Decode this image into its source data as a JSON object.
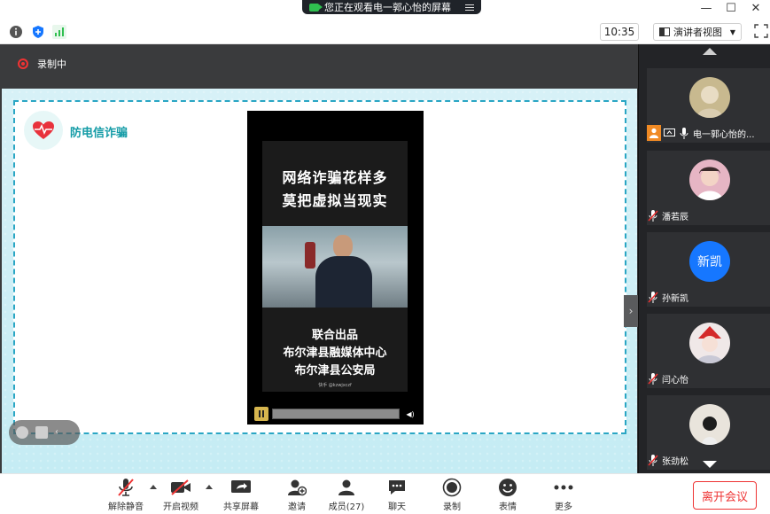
{
  "titlebar": {
    "share_status": "您正在观看电一郭心怡的屏幕",
    "minimize": "—",
    "maximize": "☐",
    "close": "✕"
  },
  "infobar": {
    "clock": "10:35",
    "view_mode": "演讲者视图"
  },
  "recording": {
    "label": "录制中"
  },
  "slide": {
    "title": "防电信诈骗",
    "video": {
      "headline_line1": "网络诈骗花样多",
      "headline_line2": "莫把虚拟当现实",
      "credit_line1": "联合出品",
      "credit_line2": "布尔津县融媒体中心",
      "credit_line3": "布尔津县公安局",
      "watermark": "快手 @kzwjxczf"
    }
  },
  "participants": [
    {
      "name": "电一郭心怡的...",
      "host": true,
      "avatar_type": "photo",
      "avatar_color": "#c8b98f"
    },
    {
      "name": "潘若辰",
      "host": false,
      "avatar_type": "photo",
      "avatar_color": "#e6b5c4"
    },
    {
      "name": "孙新凯",
      "host": false,
      "avatar_type": "text",
      "avatar_text": "新凯",
      "avatar_color": "#1677ff"
    },
    {
      "name": "闫心怡",
      "host": false,
      "avatar_type": "photo",
      "avatar_color": "#f0e8e8"
    },
    {
      "name": "张劲松",
      "host": false,
      "avatar_type": "photo",
      "avatar_color": "#e9e4dc"
    }
  ],
  "toolbar": {
    "unmute": "解除静音",
    "start_video": "开启视频",
    "share_screen": "共享屏幕",
    "invite": "邀请",
    "members": "成员(27)",
    "chat": "聊天",
    "record": "录制",
    "reactions": "表情",
    "more": "更多",
    "leave": "离开会议"
  },
  "colors": {
    "accent": "#1677ff",
    "danger": "#e33333",
    "slide_title": "#139ba6",
    "host_badge": "#f08a24"
  }
}
